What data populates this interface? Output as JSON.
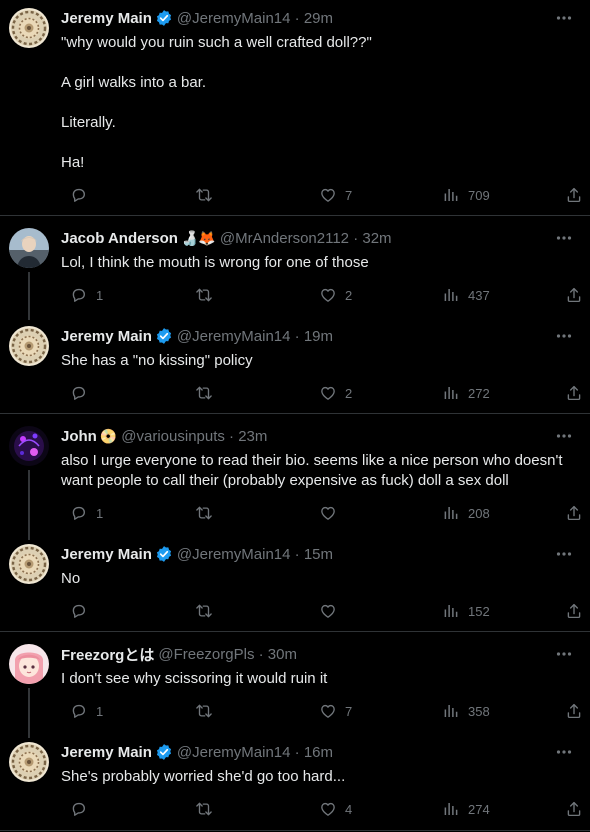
{
  "tweets": [
    {
      "name": "Jeremy Main",
      "verified": true,
      "emoji": "",
      "handle_time": "@JeremyMain14 · 29m",
      "paragraphs": [
        "\"why would you ruin such a well crafted doll??\"",
        "A girl walks into a bar.",
        "Literally.",
        "Ha!"
      ],
      "replies": "",
      "retweets": "",
      "likes": "7",
      "views": "709"
    },
    {
      "name": "Jacob Anderson",
      "verified": false,
      "emoji": "🍶🦊",
      "handle_time": "@MrAnderson2112 · 32m",
      "paragraphs": [
        "Lol, I think the mouth is wrong for one of those"
      ],
      "replies": "1",
      "retweets": "",
      "likes": "2",
      "views": "437"
    },
    {
      "name": "Jeremy Main",
      "verified": true,
      "emoji": "",
      "handle_time": "@JeremyMain14 · 19m",
      "paragraphs": [
        "She has a \"no kissing\" policy"
      ],
      "replies": "",
      "retweets": "",
      "likes": "2",
      "views": "272"
    },
    {
      "name": "John",
      "verified": false,
      "emoji": "📀",
      "handle_time": "@variousinputs · 23m",
      "paragraphs": [
        "also I urge everyone to read their bio. seems like a nice person who doesn't want people to call their (probably expensive as fuck) doll a sex doll"
      ],
      "replies": "1",
      "retweets": "",
      "likes": "",
      "views": "208"
    },
    {
      "name": "Jeremy Main",
      "verified": true,
      "emoji": "",
      "handle_time": "@JeremyMain14 · 15m",
      "paragraphs": [
        "No"
      ],
      "replies": "",
      "retweets": "",
      "likes": "",
      "views": "152"
    },
    {
      "name": "Freezorgとは",
      "verified": false,
      "emoji": "",
      "handle_time": "@FreezorgPls · 30m",
      "paragraphs": [
        "I don't see why scissoring it would ruin it"
      ],
      "replies": "1",
      "retweets": "",
      "likes": "7",
      "views": "358"
    },
    {
      "name": "Jeremy Main",
      "verified": true,
      "emoji": "",
      "handle_time": "@JeremyMain14 · 16m",
      "paragraphs": [
        "She's probably worried she'd go too hard..."
      ],
      "replies": "",
      "retweets": "",
      "likes": "4",
      "views": "274"
    }
  ],
  "colors": {
    "background": "#000000",
    "text": "#e7e9ea",
    "muted": "#71767b",
    "verified": "#1d9bf0",
    "divider": "#2f3336"
  }
}
